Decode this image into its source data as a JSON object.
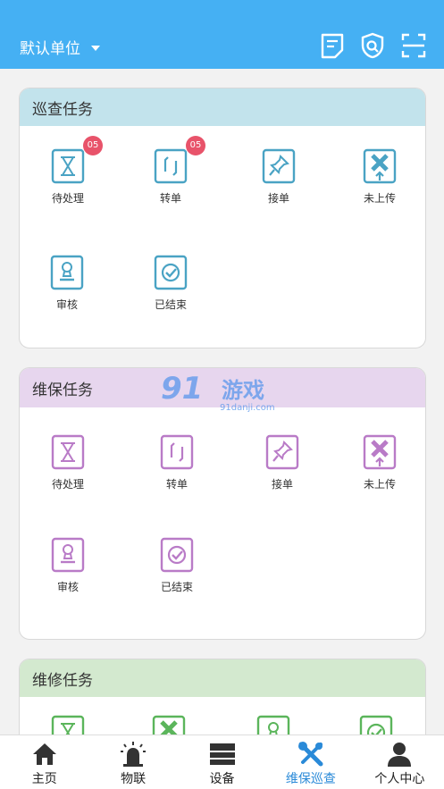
{
  "header": {
    "unit_label": "默认单位",
    "icons": [
      "notes-icon",
      "shield-search-icon",
      "scan-icon"
    ]
  },
  "colors": {
    "header": "#45b0f3",
    "patrol_accent": "#4aa3c4",
    "maintain_accent": "#b97bc7",
    "repair_accent": "#5bb55b",
    "badge": "#e8536a",
    "active_tab": "#2a8ad8"
  },
  "patrol": {
    "title": "巡查任务",
    "items": [
      {
        "label": "待处理",
        "icon": "hourglass-icon",
        "badge": "05"
      },
      {
        "label": "转单",
        "icon": "transfer-icon",
        "badge": "05"
      },
      {
        "label": "接单",
        "icon": "pin-icon"
      },
      {
        "label": "未上传",
        "icon": "not-uploaded-icon"
      },
      {
        "label": "审核",
        "icon": "stamp-icon"
      },
      {
        "label": "已结束",
        "icon": "check-circle-icon"
      }
    ]
  },
  "maintain": {
    "title": "维保任务",
    "items": [
      {
        "label": "待处理",
        "icon": "hourglass-icon"
      },
      {
        "label": "转单",
        "icon": "transfer-icon"
      },
      {
        "label": "接单",
        "icon": "pin-icon"
      },
      {
        "label": "未上传",
        "icon": "not-uploaded-icon"
      },
      {
        "label": "审核",
        "icon": "stamp-icon"
      },
      {
        "label": "已结束",
        "icon": "check-circle-icon"
      }
    ]
  },
  "repair": {
    "title": "维修任务"
  },
  "watermark": {
    "big": "91",
    "cn": "游戏",
    "url": "91danji.com"
  },
  "tabbar": [
    {
      "label": "主页",
      "icon": "home-icon"
    },
    {
      "label": "物联",
      "icon": "alarm-light-icon"
    },
    {
      "label": "设备",
      "icon": "device-icon"
    },
    {
      "label": "维保巡查",
      "icon": "tools-icon",
      "active": true
    },
    {
      "label": "个人中心",
      "icon": "person-icon"
    }
  ]
}
